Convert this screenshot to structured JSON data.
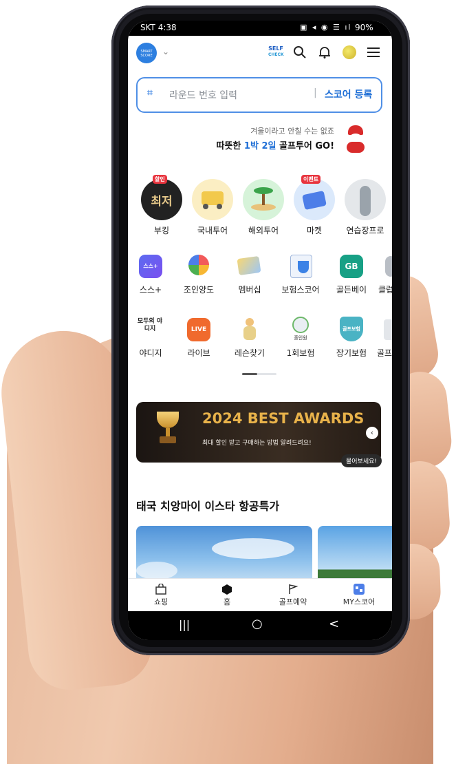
{
  "status_bar": {
    "carrier_time": "SKT 4:38",
    "battery": "90%"
  },
  "header": {
    "logo_text": "SMART SCORE",
    "self_check_line1": "SELF",
    "self_check_line2": "CHECK"
  },
  "search": {
    "placeholder": "라운드 번호 입력",
    "register_label": "스코어 등록"
  },
  "promo": {
    "line1": "겨울이라고 안칠 수는 없죠",
    "line2_prefix": "따뜻한 ",
    "line2_highlight": "1박 2일",
    "line2_suffix": " 골프투어 GO!"
  },
  "categories": [
    {
      "label": "부킹",
      "tag": "할인",
      "inner_text": "최저"
    },
    {
      "label": "국내투어",
      "tag": "",
      "inner_text": ""
    },
    {
      "label": "해외투어",
      "tag": "",
      "inner_text": ""
    },
    {
      "label": "마켓",
      "tag": "이벤트",
      "inner_text": ""
    },
    {
      "label": "연습장프로",
      "tag": "",
      "inner_text": ""
    }
  ],
  "services_row1": [
    "스스+",
    "조인양도",
    "멤버십",
    "보험스코어",
    "골든베이",
    "클럽"
  ],
  "services_row2": [
    "야디지",
    "라이브",
    "레슨찾기",
    "1회보험",
    "장기보험",
    "골프"
  ],
  "service_icon_text": {
    "ss_plus": "스스+",
    "yardage": "모두의 야디지",
    "live": "LIVE",
    "golden": "GB",
    "insurance1": "홀인원",
    "insurance2": "골프보험"
  },
  "banner": {
    "title": "2024 BEST AWARDS",
    "subtitle": "최대 할인 받고 구매하는 방법 알려드려요!",
    "tooltip": "물어보세요!"
  },
  "section": {
    "title": "태국 치앙마이 이스타 항공특가"
  },
  "tab_bar": [
    {
      "label": "쇼핑"
    },
    {
      "label": "홈"
    },
    {
      "label": "골프예약"
    },
    {
      "label": "MY스코어"
    }
  ],
  "nav": {
    "recent": "|||",
    "home": "○",
    "back": "<"
  },
  "colors": {
    "accent": "#1f6fd6",
    "tag_red": "#e8343e",
    "banner_gold": "#e8b24a"
  }
}
